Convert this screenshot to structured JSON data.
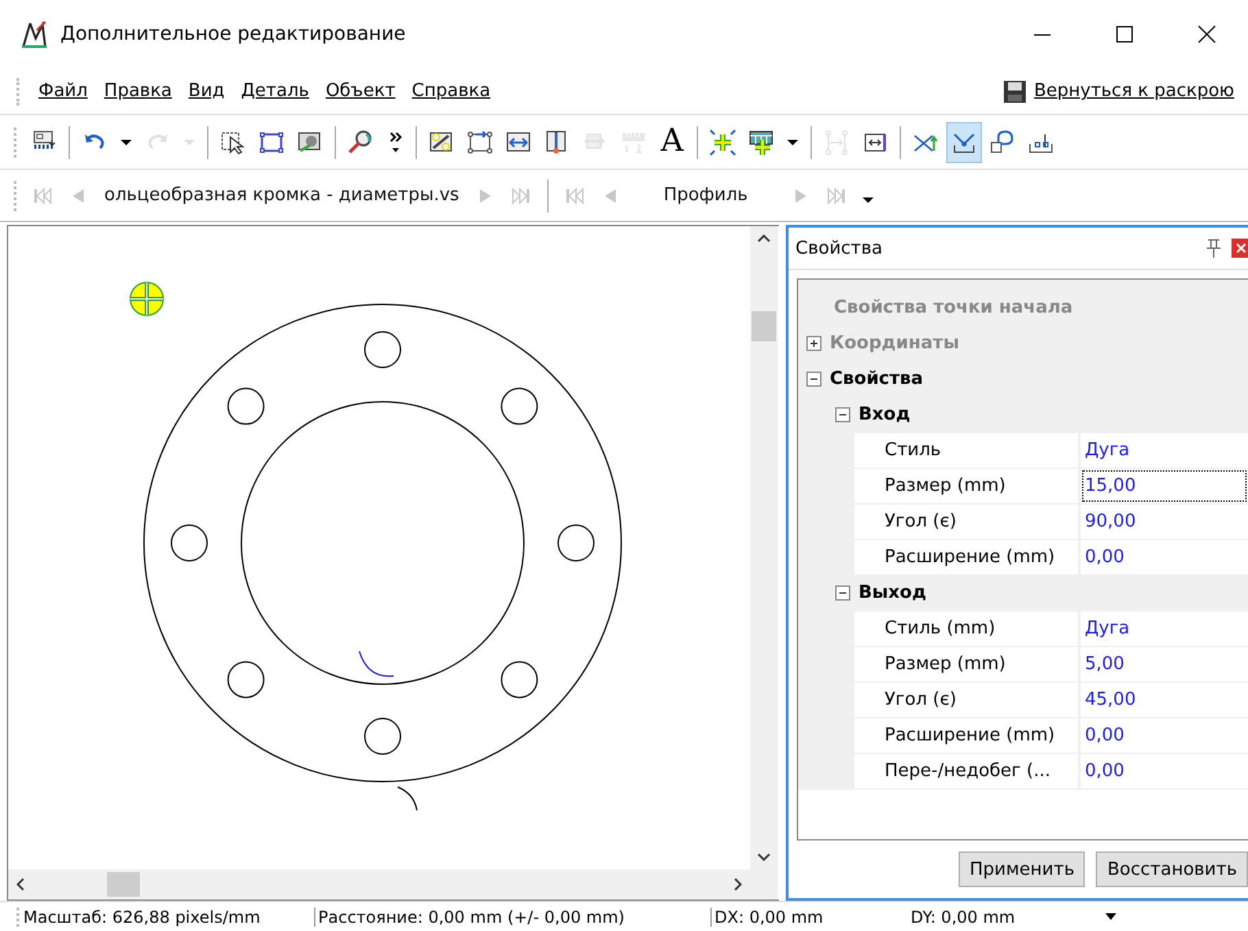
{
  "window": {
    "title": "Дополнительное редактирование"
  },
  "menu": {
    "items": [
      "Файл",
      "Правка",
      "Вид",
      "Деталь",
      "Объект",
      "Справка"
    ],
    "return_button": "Вернуться к раскрою"
  },
  "toolbar": {
    "groups": [
      {
        "items": [
          {
            "kind": "export",
            "disabled": false,
            "selected": false
          }
        ]
      },
      {
        "items": [
          {
            "kind": "undo",
            "disabled": false,
            "selected": false
          },
          {
            "kind": "menu",
            "disabled": false,
            "selected": false
          },
          {
            "kind": "redo",
            "disabled": true,
            "selected": false
          },
          {
            "kind": "menu",
            "disabled": true,
            "selected": false
          }
        ]
      },
      {
        "items": [
          {
            "kind": "select",
            "disabled": false,
            "selected": false
          },
          {
            "kind": "rectangle",
            "disabled": false,
            "selected": false
          },
          {
            "kind": "swap",
            "disabled": false,
            "selected": false
          }
        ]
      },
      {
        "items": [
          {
            "kind": "zoom",
            "disabled": false,
            "selected": false
          },
          {
            "kind": "more",
            "disabled": false,
            "selected": false
          }
        ]
      },
      {
        "items": [
          {
            "kind": "numbered",
            "disabled": false,
            "selected": false
          },
          {
            "kind": "corners",
            "disabled": false,
            "selected": false
          },
          {
            "kind": "replace",
            "disabled": false,
            "selected": false
          },
          {
            "kind": "book",
            "disabled": false,
            "selected": false
          },
          {
            "kind": "move",
            "disabled": true,
            "selected": false
          },
          {
            "kind": "ruler",
            "disabled": true,
            "selected": false
          },
          {
            "kind": "text",
            "label": "A",
            "disabled": false,
            "selected": false
          }
        ]
      },
      {
        "items": [
          {
            "kind": "addfit",
            "disabled": false,
            "selected": false
          },
          {
            "kind": "addtable",
            "disabled": false,
            "selected": false
          },
          {
            "kind": "menu",
            "disabled": false,
            "selected": false
          }
        ]
      },
      {
        "items": [
          {
            "kind": "spacing",
            "disabled": true,
            "selected": false
          },
          {
            "kind": "dimension",
            "disabled": false,
            "selected": false
          }
        ]
      },
      {
        "items": [
          {
            "kind": "trim",
            "disabled": false,
            "selected": false
          },
          {
            "kind": "corner",
            "disabled": false,
            "selected": true
          },
          {
            "kind": "loop",
            "disabled": false,
            "selected": false
          },
          {
            "kind": "base",
            "disabled": false,
            "selected": false
          }
        ]
      }
    ]
  },
  "navbar": {
    "groups": [
      {
        "items": [
          {
            "kind": "first",
            "disabled": true
          },
          {
            "kind": "prev",
            "disabled": true
          },
          {
            "kind": "label",
            "text": "ольцеобразная кромка - диаметры.vs"
          },
          {
            "kind": "next",
            "disabled": true
          },
          {
            "kind": "last",
            "disabled": true
          }
        ]
      },
      {
        "items": [
          {
            "kind": "first",
            "disabled": true
          },
          {
            "kind": "prev",
            "disabled": true
          },
          {
            "kind": "label",
            "text": "Профиль"
          },
          {
            "kind": "next",
            "disabled": true
          },
          {
            "kind": "last",
            "disabled": true
          },
          {
            "kind": "more"
          }
        ]
      }
    ]
  },
  "properties": {
    "title": "Свойства",
    "caption": "Свойства точки начала",
    "groups": [
      {
        "label": "Координаты",
        "expanded": false,
        "disabled": true
      },
      {
        "label": "Свойства",
        "expanded": true,
        "disabled": false,
        "children": [
          {
            "label": "Вход",
            "expanded": true,
            "rows": [
              {
                "name": "Стиль",
                "value": "Дуга",
                "selected": false
              },
              {
                "name": "Размер (mm)",
                "value": "15,00",
                "selected": true
              },
              {
                "name": "Угол (є)",
                "value": "90,00",
                "selected": false
              },
              {
                "name": "Расширение (mm)",
                "value": "0,00",
                "selected": false
              }
            ]
          },
          {
            "label": "Выход",
            "expanded": true,
            "rows": [
              {
                "name": "Стиль (mm)",
                "value": "Дуга",
                "selected": false
              },
              {
                "name": "Размер (mm)",
                "value": "5,00",
                "selected": false
              },
              {
                "name": "Угол (є)",
                "value": "45,00",
                "selected": false
              },
              {
                "name": "Расширение (mm)",
                "value": "0,00",
                "selected": false
              },
              {
                "name": "Пере-/недобег (...",
                "value": "0,00",
                "selected": false
              }
            ]
          }
        ]
      }
    ],
    "buttons": [
      "Применить",
      "Восстановить"
    ]
  },
  "status_bar": [
    "Масштаб: 626,88 pixels/mm",
    "Расстояние: 0,00 mm (+/- 0,00 mm)",
    "DX: 0,00 mm",
    "DY: 0,00 mm"
  ]
}
